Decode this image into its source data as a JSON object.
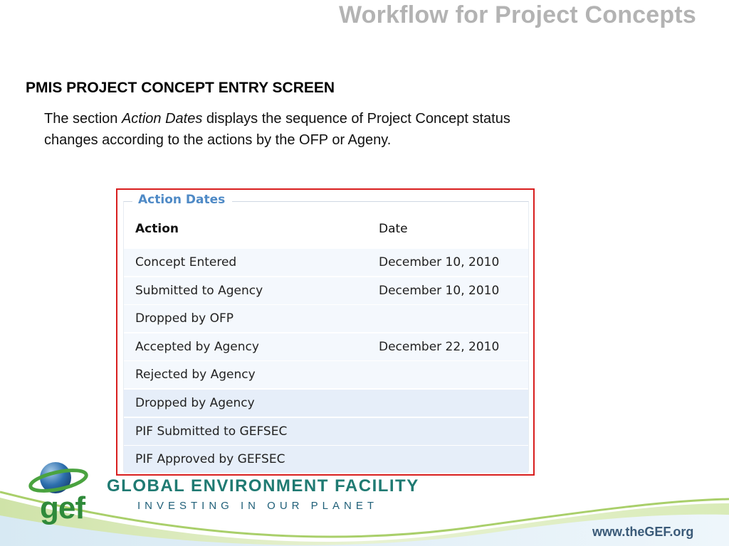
{
  "slide": {
    "title": "Workflow for Project Concepts",
    "heading": "PMIS PROJECT CONCEPT ENTRY SCREEN",
    "body_prefix": "The section ",
    "body_emphasis": "Action Dates",
    "body_suffix": " displays the sequence of Project Concept status changes according to the actions by the OFP or Ageny."
  },
  "action_dates": {
    "legend": "Action Dates",
    "columns": [
      "Action",
      "Date"
    ],
    "rows": [
      {
        "action": "Concept Entered",
        "date": "December 10, 2010"
      },
      {
        "action": "Submitted to Agency",
        "date": "December 10, 2010"
      },
      {
        "action": "Dropped by OFP",
        "date": ""
      },
      {
        "action": "Accepted by Agency",
        "date": "December 22, 2010"
      },
      {
        "action": "Rejected by Agency",
        "date": ""
      },
      {
        "action": "Dropped by Agency",
        "date": ""
      },
      {
        "action": "PIF Submitted to GEFSEC",
        "date": ""
      },
      {
        "action": "PIF Approved by GEFSEC",
        "date": ""
      }
    ],
    "highlight_color": "#d81e1e"
  },
  "footer": {
    "logo_text": "gef",
    "org_name": "GLOBAL ENVIRONMENT FACILITY",
    "tagline": "INVESTING IN OUR PLANET",
    "website": "www.theGEF.org"
  },
  "icons": {
    "logo": "globe-logo-icon"
  }
}
